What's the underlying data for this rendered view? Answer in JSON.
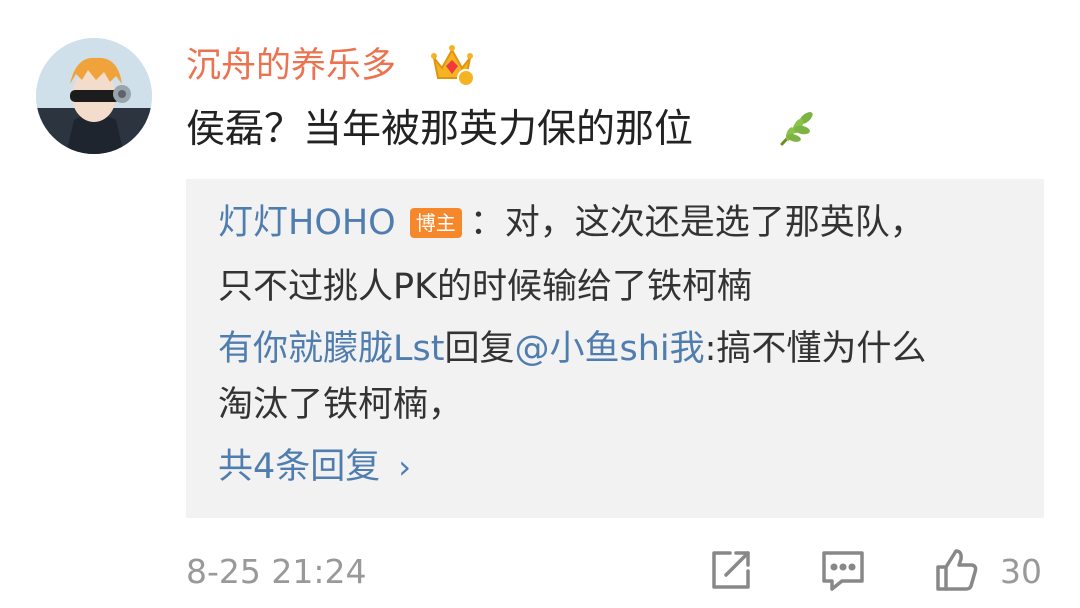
{
  "comment": {
    "username": "沉舟的养乐多",
    "text": "侯磊？当年被那英力保的那位",
    "timestamp": "8-25 21:24",
    "like_count": "30",
    "icons": {
      "avatar": "anime-avatar",
      "crown": "vip-crown-icon",
      "leaf": "leaf-emoji",
      "share": "share-icon",
      "reply": "comment-icon",
      "like": "thumbs-up-icon"
    }
  },
  "replies": {
    "reply1": {
      "author": "灯灯HOHO",
      "badge": "博主",
      "line1": "：对，这次还是选了那英队，",
      "line2": "只不过挑人PK的时候输给了铁柯楠"
    },
    "reply2": {
      "author": "有你就朦胧Lst",
      "action": "回复",
      "mention": "@小鱼shi我",
      "line1": ":搞不懂为什么",
      "line2": "淘汰了铁柯楠，"
    },
    "more_label": "共4条回复",
    "more_chevron": "›"
  },
  "colors": {
    "username": "#eb7350",
    "link": "#507daf",
    "badge": "#f6882b",
    "reply_bg": "#f2f2f2",
    "muted": "#999999"
  }
}
